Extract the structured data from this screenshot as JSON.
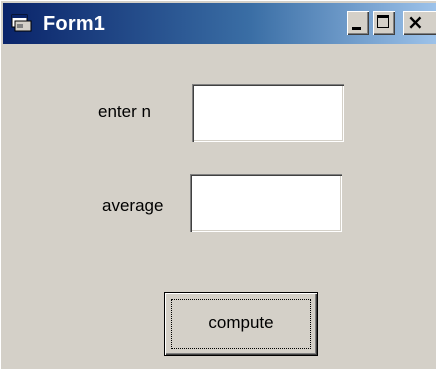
{
  "window": {
    "title": "Form1",
    "icon": "form-app-icon",
    "controls": {
      "minimize": "minimize-icon",
      "maximize": "maximize-icon",
      "close": "close-icon",
      "close_glyph": "×"
    }
  },
  "form": {
    "n_label": "enter n",
    "n_value": "",
    "average_label": "average",
    "average_value": "",
    "compute_label": "compute"
  },
  "colors": {
    "face": "#d4d0c8",
    "title_start": "#0a246a",
    "title_end": "#a6caf0"
  }
}
